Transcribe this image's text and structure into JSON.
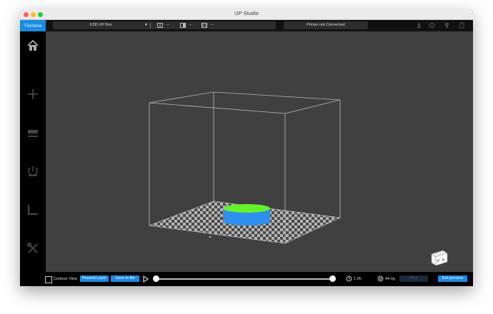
{
  "window": {
    "title": "UP Studio"
  },
  "brand": {
    "logo_text": "Tiertime",
    "accent": "#1c8be0"
  },
  "toolbar": {
    "printer_name": "K3D UP Box",
    "dim_x": "---",
    "dim_y": "---",
    "dim_z": "---",
    "printer_status": "Printer not Connected",
    "icons": [
      "account-icon",
      "settings-icon",
      "shirt-icon",
      "book-icon"
    ]
  },
  "sidebar": {
    "items": [
      "home-icon",
      "add-icon",
      "print-icon",
      "calibrate-icon",
      "levels-icon",
      "tools-icon"
    ]
  },
  "viewport": {
    "background": "#404040",
    "model_top_color": "#66f22a",
    "model_side_color": "#2f8fef",
    "view_cube_labels": [
      "F",
      "R"
    ]
  },
  "bottombar": {
    "contour_view_label": "Contour View",
    "paused_layer_label": "Paused Layer",
    "save_to_file_label": "Save to file",
    "time_estimate": "1.9h",
    "weight_estimate": "44.0g",
    "print_label": "Print",
    "exit_preview_label": "Exit preview"
  }
}
